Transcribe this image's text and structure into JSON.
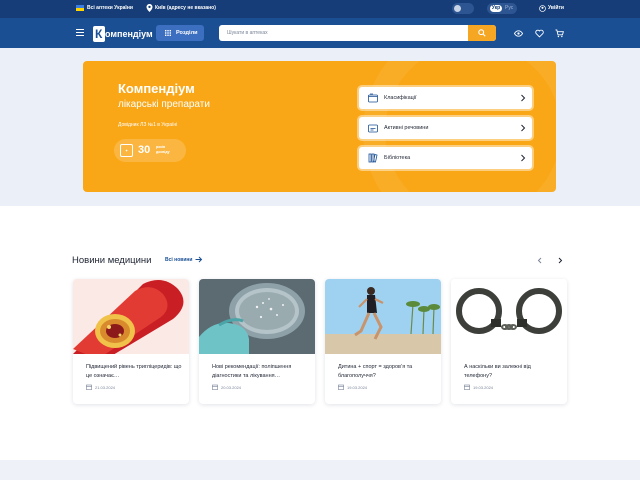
{
  "topbar": {
    "pharmacies_label": "Всі аптеки України",
    "city_label": "Київ (адресу не вказано)",
    "lang_ua": "Укр",
    "lang_ru": "Рус",
    "login_label": "Увійти"
  },
  "header": {
    "logo_text": "омпендіум",
    "logo_letter": "К",
    "sections_label": "Розділи",
    "search_placeholder": "Шукати в аптеках"
  },
  "hero": {
    "title": "Компендіум",
    "subtitle": "лікарські препарати",
    "reference": "Довідник ЛЗ №1 в Україні",
    "years_number": "30",
    "years_label": "років досвіду",
    "links": [
      {
        "label": "Класифікації",
        "icon": "classification-icon"
      },
      {
        "label": "Активні речовини",
        "icon": "substance-icon"
      },
      {
        "label": "Бібліотека",
        "icon": "library-icon"
      }
    ]
  },
  "news": {
    "title": "Новини медицини",
    "all_label": "Всі новини",
    "items": [
      {
        "title": "Підвищений рівень тригліцеридів: що це означає…",
        "date": "21.03.2024"
      },
      {
        "title": "Нові рекомендації: поліпшення діагностики та лікування…",
        "date": "20.03.2024"
      },
      {
        "title": "Дитина + спорт = здоров’я та благополуччя?",
        "date": "19.03.2024"
      },
      {
        "title": "А наскільки ви залежні від телефону?",
        "date": "19.03.2024"
      }
    ]
  },
  "colors": {
    "brand_dark": "#163d77",
    "brand": "#1a4f94",
    "accent": "#f9a717"
  }
}
